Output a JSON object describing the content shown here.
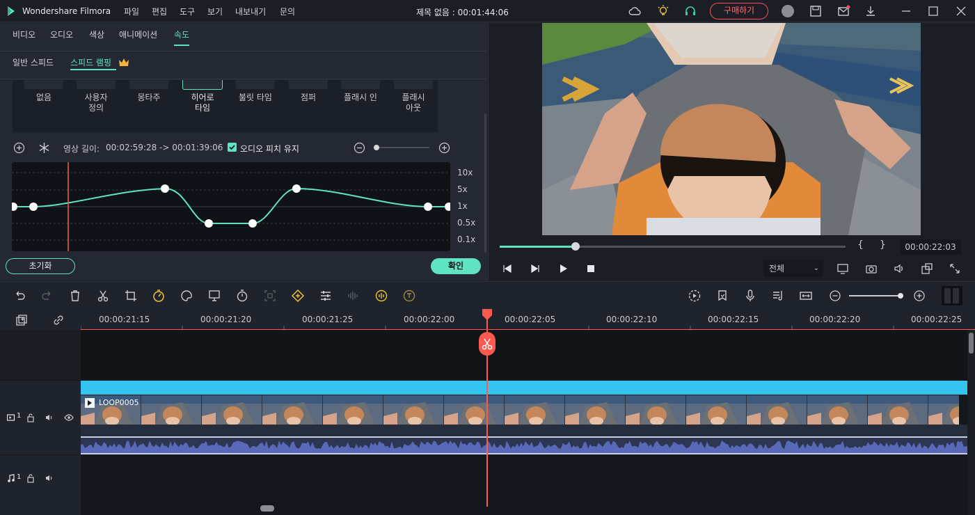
{
  "app": {
    "name": "Wondershare Filmora",
    "project_title": "제목 없음 : 00:01:44:06",
    "buy_label": "구매하기"
  },
  "menu": [
    "파일",
    "편집",
    "도구",
    "보기",
    "내보내기",
    "문의"
  ],
  "editor_tabs": [
    "비디오",
    "오디오",
    "색상",
    "애니메이션",
    "속도"
  ],
  "speed_tabs": [
    "일반 스피드",
    "스피드 램핑"
  ],
  "presets": [
    "없음",
    "사용자\n정의",
    "몽타주",
    "히어로\n타임",
    "불릿 타임",
    "점퍼",
    "플래시 인",
    "플래시\n아웃"
  ],
  "speed_info": {
    "label": "영상 길이:",
    "value": "00:02:59:28 -> 00:01:39:06",
    "keep_pitch": "오디오 피치 유지"
  },
  "y_labels": [
    "10x",
    "5x",
    "1x",
    "0.5x",
    "0.1x"
  ],
  "buttons": {
    "reset": "초기화",
    "ok": "확인"
  },
  "preview": {
    "timecode": "00:00:22:03",
    "quality": "전체",
    "seek_progress": 0.22
  },
  "ruler": [
    "00:00:21:15",
    "00:00:21:20",
    "00:00:21:25",
    "00:00:22:00",
    "00:00:22:05",
    "00:00:22:10",
    "00:00:22:15",
    "00:00:22:20",
    "00:00:22:25"
  ],
  "clip": {
    "name": "LOOP0005"
  },
  "tracks": {
    "video": "1",
    "audio": "1"
  }
}
